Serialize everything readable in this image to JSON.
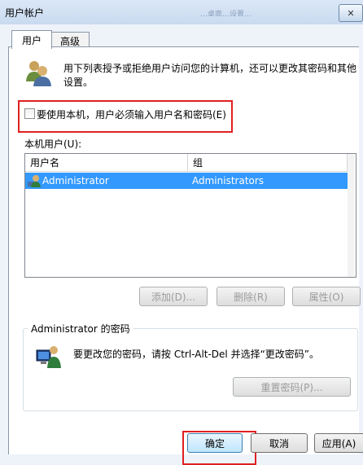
{
  "window": {
    "title": "用户帐户",
    "ghost_text": "…桌面…设置…"
  },
  "tabs": [
    {
      "label": "用户"
    },
    {
      "label": "高级"
    }
  ],
  "intro": {
    "text_line1": "用下列表授予或拒绝用户访问您的计算机，还可以更改其密码和其他",
    "text_line2": "设置。"
  },
  "require_login": {
    "label": "要使用本机，用户必须输入用户名和密码(E)",
    "checked": false
  },
  "local_users": {
    "label": "本机用户(U):",
    "columns": [
      "用户名",
      "组"
    ],
    "rows": [
      {
        "username": "Administrator",
        "group": "Administrators"
      }
    ]
  },
  "user_buttons": {
    "add": "添加(D)...",
    "remove": "删除(R)",
    "properties": "属性(O)"
  },
  "password_group": {
    "title": "Administrator 的密码",
    "text": "要更改您的密码，请按 Ctrl-Alt-Del 并选择“更改密码”。",
    "reset_button": "重置密码(P)..."
  },
  "dialog_buttons": {
    "ok": "确定",
    "cancel": "取消",
    "apply": "应用(A)"
  },
  "colors": {
    "selection": "#3399ff",
    "highlight_box": "#e02020"
  }
}
